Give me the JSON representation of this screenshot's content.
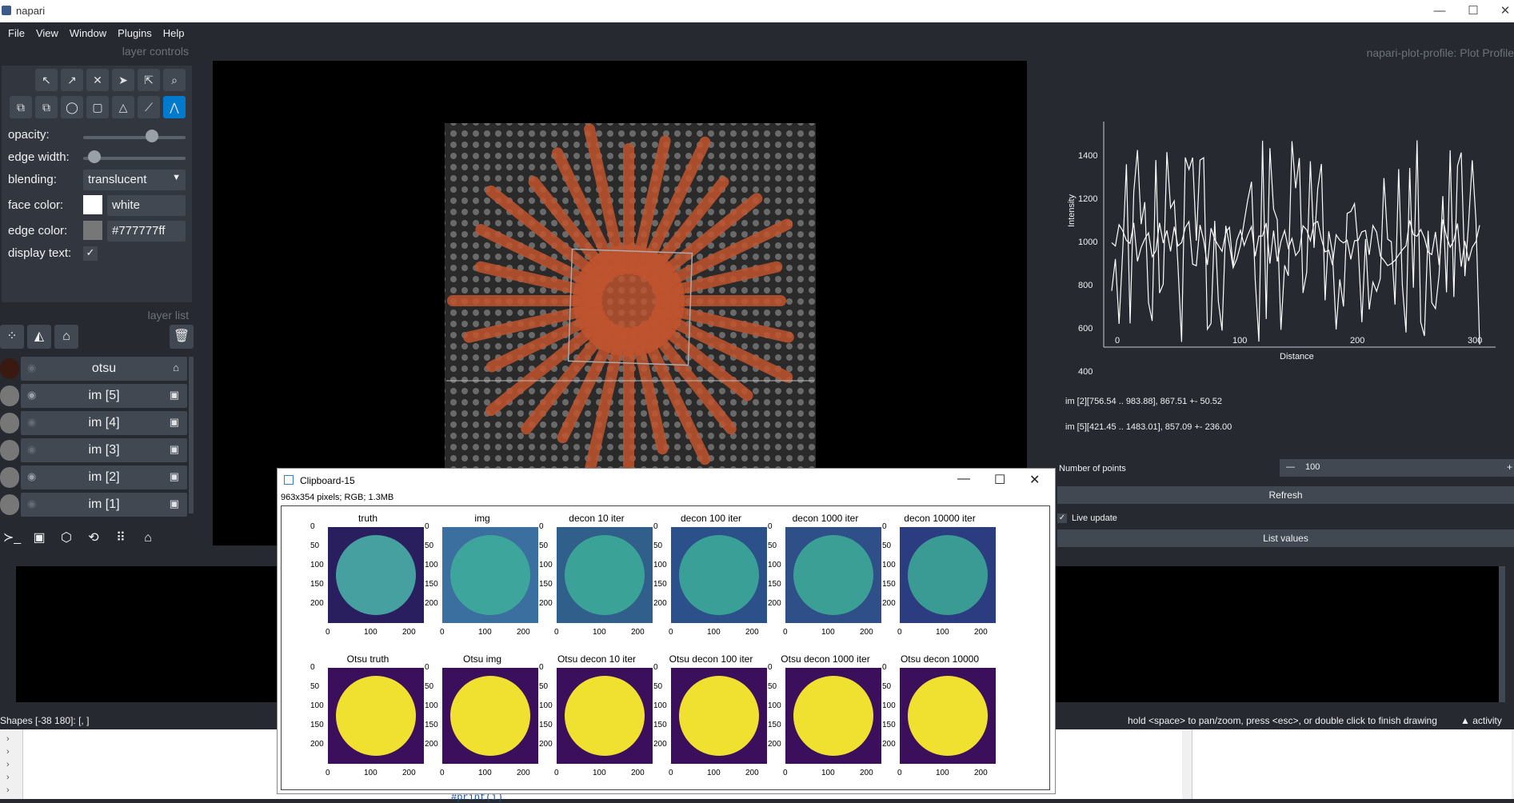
{
  "window": {
    "title": "napari",
    "min_label": "—",
    "max_label": "☐",
    "close_label": "✕"
  },
  "menu": [
    "File",
    "View",
    "Window",
    "Plugins",
    "Help"
  ],
  "layer_controls": {
    "header": "layer controls",
    "opacity_label": "opacity:",
    "opacity_value": 0.7,
    "edge_width_label": "edge width:",
    "edge_width_value": 0.05,
    "blending_label": "blending:",
    "blending_value": "translucent",
    "face_color_label": "face color:",
    "face_color_value": "white",
    "face_color_hex": "#ffffff",
    "edge_color_label": "edge color:",
    "edge_color_value": "#777777ff",
    "edge_color_hex": "#777777",
    "display_text_label": "display text:",
    "display_text_checked": "✓"
  },
  "layer_list": {
    "header": "layer list",
    "layers": [
      {
        "name": "otsu",
        "visible": "hidden"
      },
      {
        "name": "im [5]",
        "visible": "shown"
      },
      {
        "name": "im [4]",
        "visible": "hidden"
      },
      {
        "name": "im [3]",
        "visible": "hidden"
      },
      {
        "name": "im [2]",
        "visible": "shown"
      },
      {
        "name": "im [1]",
        "visible": "hidden"
      }
    ]
  },
  "plot_panel": {
    "header": "napari-plot-profile: Plot Profile",
    "ylabel": "Intensity",
    "xlabel": "Distance",
    "yticks": [
      "1400",
      "1200",
      "1000",
      "800",
      "600",
      "400"
    ],
    "xticks": [
      "0",
      "100",
      "200",
      "300"
    ],
    "stats": [
      "im [2][756.54 .. 983.88], 867.51 +- 50.52",
      "im [5][421.45 .. 1483.01], 857.09 +- 236.00"
    ],
    "num_points_label": "Number of points",
    "num_points_value": "100",
    "minus_label": "—",
    "plus_label": "+",
    "refresh_label": "Refresh",
    "live_update_label": "Live update",
    "list_values_label": "List values"
  },
  "statusbar": {
    "left": "Shapes [-38 180]: [, ]",
    "hint": "hold <space> to pan/zoom, press <esc>, or double click to finish drawing",
    "activity": "▲ activity"
  },
  "clipboard": {
    "title": "Clipboard-15",
    "info": "963x354 pixels; RGB; 1.3MB",
    "row1_titles": [
      "truth",
      "img",
      "decon 10 iter",
      "decon 100 iter",
      "decon 1000 iter",
      "decon 10000 iter"
    ],
    "row2_titles": [
      "Otsu truth",
      "Otsu img",
      "Otsu decon 10 iter",
      "Otsu decon 100 iter",
      "Otsu decon 1000 iter",
      "Otsu decon 10000"
    ],
    "yticks": [
      "0",
      "50",
      "100",
      "150",
      "200"
    ],
    "xticks": [
      "0",
      "100",
      "200"
    ]
  },
  "bottom": {
    "code_text": "#print(i)"
  },
  "icons": [
    "minimize-icon",
    "maximize-icon",
    "close-icon",
    "eye-icon",
    "trash-icon",
    "console-icon",
    "home-icon",
    "grid-icon"
  ]
}
